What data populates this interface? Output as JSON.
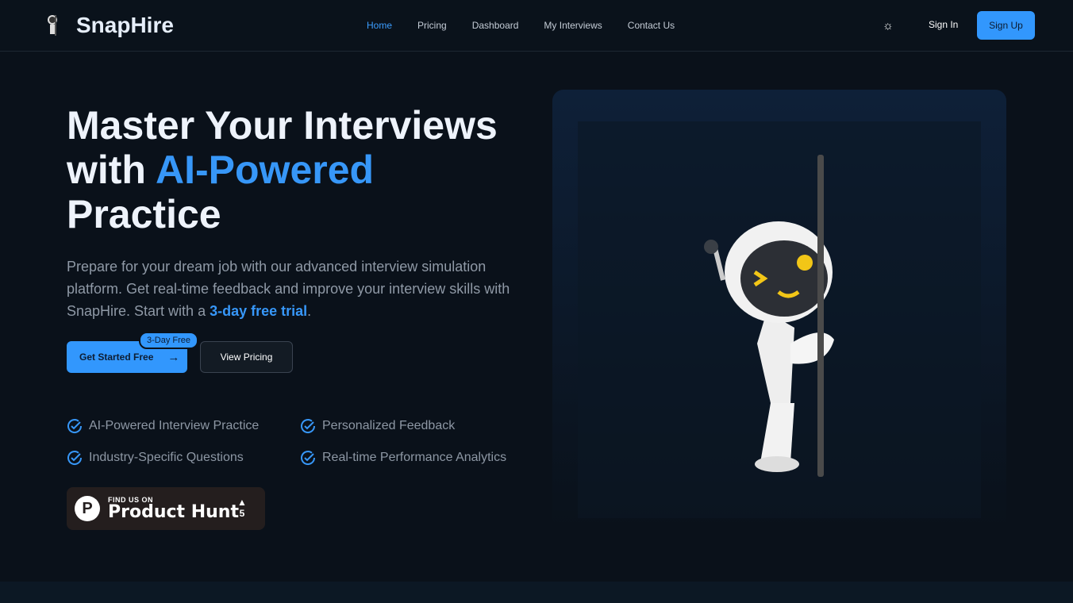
{
  "nav": {
    "brand": "SnapHire",
    "links": [
      "Home",
      "Pricing",
      "Dashboard",
      "My Interviews",
      "Contact Us"
    ],
    "signin": "Sign In",
    "signup": "Sign Up"
  },
  "hero": {
    "title_1": "Master Your Interviews",
    "title_2": "with ",
    "title_accent": "AI-Powered",
    "title_3": "Practice",
    "desc": "Prepare for your dream job with our advanced interview simulation platform. Get real-time feedback and improve your interview skills with SnapHire. Start with a ",
    "desc_link": "3-day free trial",
    "desc_end": ".",
    "cta": "Get Started Free",
    "badge": "3-Day Free",
    "view_pricing": "View Pricing",
    "features": [
      "AI-Powered Interview Practice",
      "Personalized Feedback",
      "Industry-Specific Questions",
      "Real-time Performance Analytics"
    ]
  },
  "producthunt": {
    "small": "FIND US ON",
    "big": "Product Hunt",
    "votes": "5"
  },
  "colors": {
    "accent": "#3297fd",
    "bg": "#0a111a"
  }
}
